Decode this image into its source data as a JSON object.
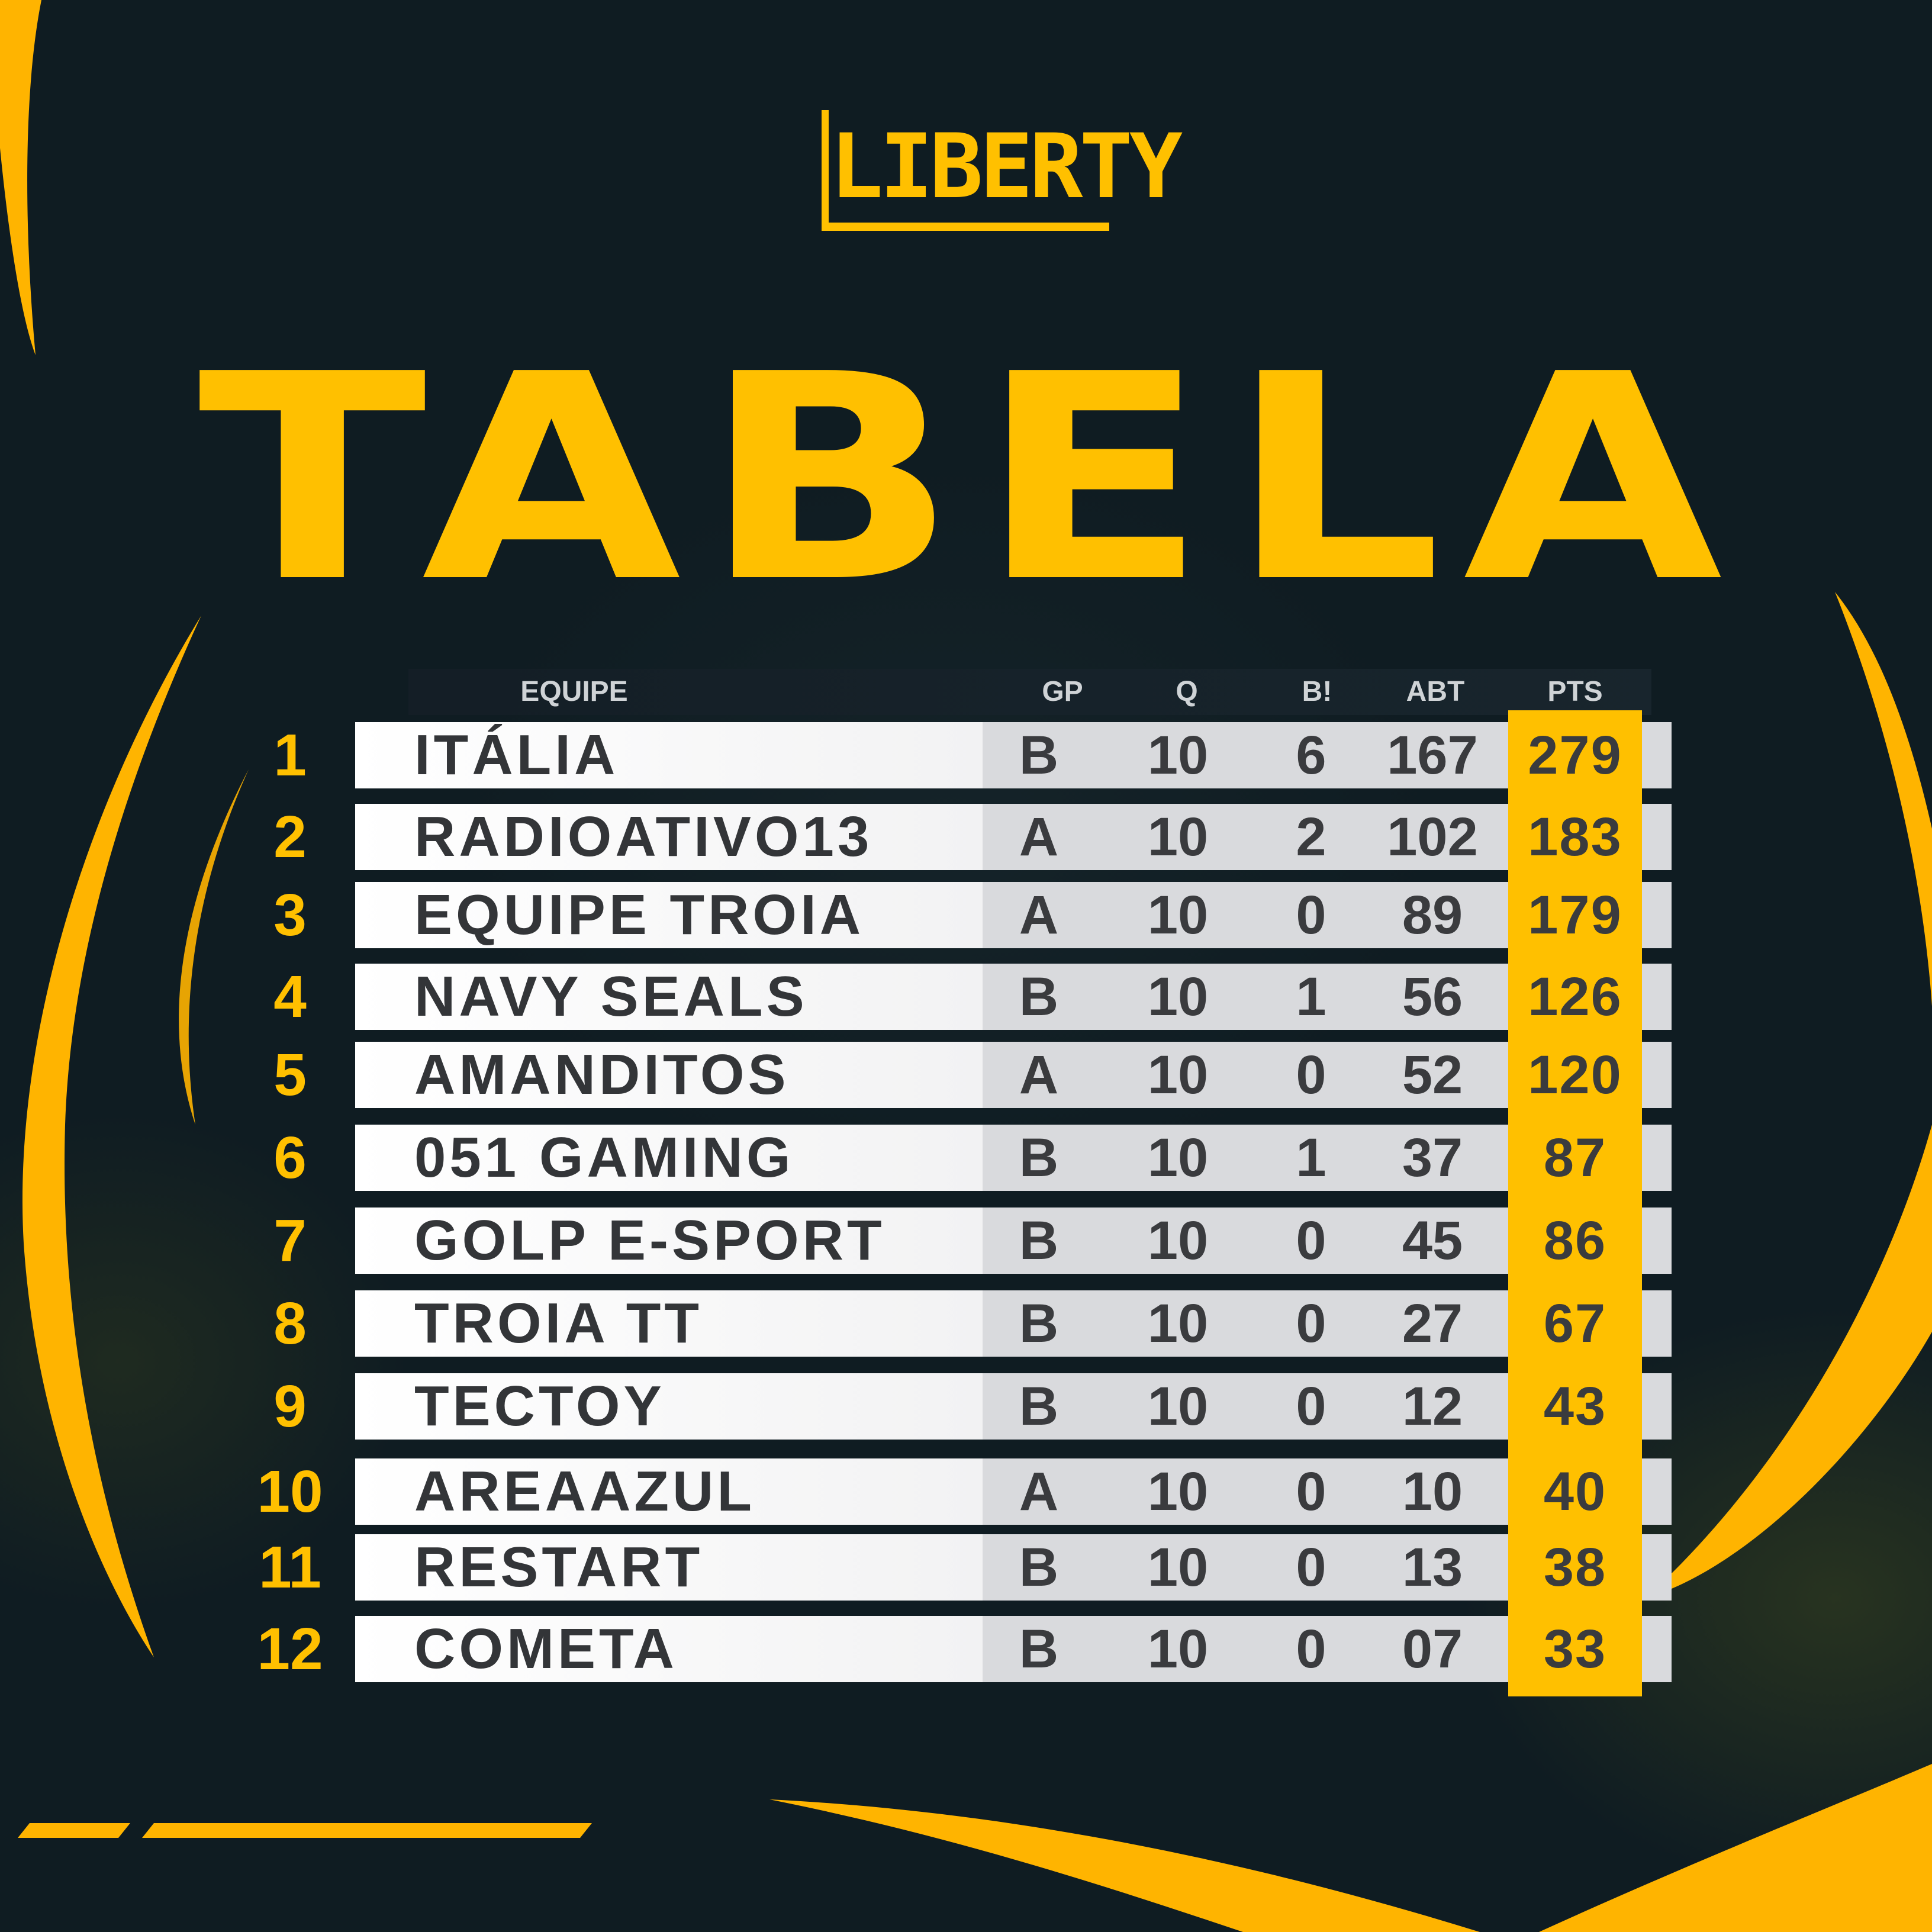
{
  "brand": {
    "logo_text": "LIBERTY",
    "accent_color": "#ffc000",
    "background_color": "#0f1c22"
  },
  "title": "TABELA",
  "table": {
    "headers": {
      "team": "EQUIPE",
      "group": "GP",
      "q": "Q",
      "b": "B!",
      "abt": "ABT",
      "pts": "PTS"
    },
    "rows": [
      {
        "rank": "1",
        "team": "ITÁLIA",
        "gp": "B",
        "q": "10",
        "b": "6",
        "abt": "167",
        "pts": "279"
      },
      {
        "rank": "2",
        "team": "RADIOATIVO13",
        "gp": "A",
        "q": "10",
        "b": "2",
        "abt": "102",
        "pts": "183"
      },
      {
        "rank": "3",
        "team": "EQUIPE TROIA",
        "gp": "A",
        "q": "10",
        "b": "0",
        "abt": "89",
        "pts": "179"
      },
      {
        "rank": "4",
        "team": "NAVY SEALS",
        "gp": "B",
        "q": "10",
        "b": "1",
        "abt": "56",
        "pts": "126"
      },
      {
        "rank": "5",
        "team": "AMANDITOS",
        "gp": "A",
        "q": "10",
        "b": "0",
        "abt": "52",
        "pts": "120"
      },
      {
        "rank": "6",
        "team": "051 GAMING",
        "gp": "B",
        "q": "10",
        "b": "1",
        "abt": "37",
        "pts": "87"
      },
      {
        "rank": "7",
        "team": "GOLP E-SPORT",
        "gp": "B",
        "q": "10",
        "b": "0",
        "abt": "45",
        "pts": "86"
      },
      {
        "rank": "8",
        "team": "TROIA TT",
        "gp": "B",
        "q": "10",
        "b": "0",
        "abt": "27",
        "pts": "67"
      },
      {
        "rank": "9",
        "team": "TECTOY",
        "gp": "B",
        "q": "10",
        "b": "0",
        "abt": "12",
        "pts": "43"
      },
      {
        "rank": "10",
        "team": "AREAAZUL",
        "gp": "A",
        "q": "10",
        "b": "0",
        "abt": "10",
        "pts": "40"
      },
      {
        "rank": "11",
        "team": "RESTART",
        "gp": "B",
        "q": "10",
        "b": "0",
        "abt": "13",
        "pts": "38"
      },
      {
        "rank": "12",
        "team": "COMETA",
        "gp": "B",
        "q": "10",
        "b": "0",
        "abt": "07",
        "pts": "33"
      }
    ]
  }
}
